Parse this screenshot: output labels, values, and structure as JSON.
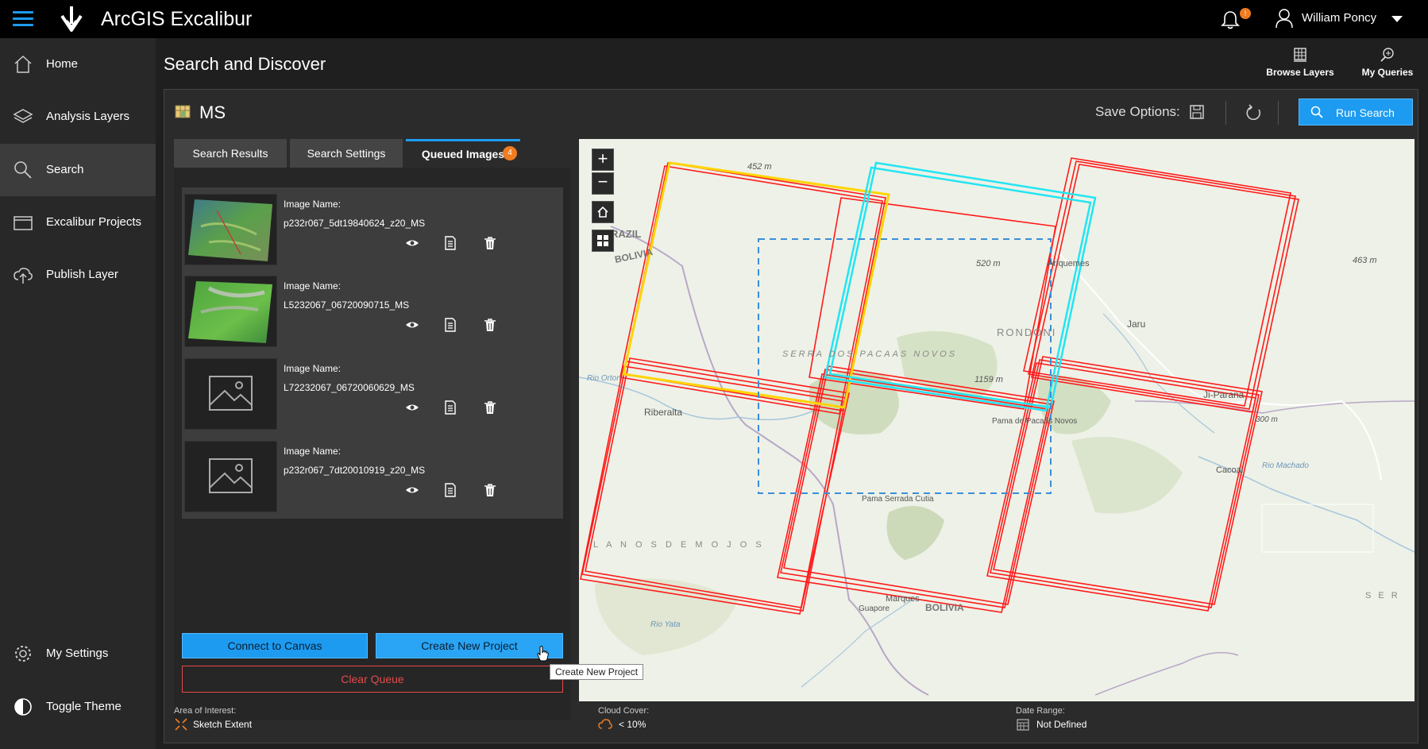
{
  "app": {
    "title": "ArcGIS Excalibur"
  },
  "user": {
    "name": "William Poncy",
    "notifications": "!"
  },
  "sidebar": {
    "items": [
      {
        "label": "Home"
      },
      {
        "label": "Analysis Layers"
      },
      {
        "label": "Search"
      },
      {
        "label": "Excalibur Projects"
      },
      {
        "label": "Publish Layer"
      },
      {
        "label": "My Settings"
      },
      {
        "label": "Toggle Theme"
      }
    ]
  },
  "page": {
    "title": "Search and Discover"
  },
  "top_actions": {
    "browse": "Browse Layers",
    "queries": "My Queries"
  },
  "panel": {
    "title": "MS",
    "save_options_label": "Save Options:",
    "run_search_label": "Run Search"
  },
  "tabs": [
    {
      "label": "Search Results"
    },
    {
      "label": "Search Settings"
    },
    {
      "label": "Queued Images",
      "badge": "4"
    }
  ],
  "queue": {
    "items": [
      {
        "label": "Image Name:",
        "name": "p232r067_5dt19840624_z20_MS",
        "thumb": "imagery"
      },
      {
        "label": "Image Name:",
        "name": "L5232067_06720090715_MS",
        "thumb": "imagery"
      },
      {
        "label": "Image Name:",
        "name": "L72232067_06720060629_MS",
        "thumb": "placeholder"
      },
      {
        "label": "Image Name:",
        "name": "p232r067_7dt20010919_z20_MS",
        "thumb": "placeholder"
      }
    ],
    "connect_label": "Connect to Canvas",
    "create_label": "Create New Project",
    "clear_label": "Clear Queue",
    "tooltip": "Create New Project"
  },
  "map": {
    "labels": {
      "elev_452": "452 m",
      "brazil": "RAZIL",
      "bolivia": "BOLIVIA",
      "elev_520": "520 m",
      "ariquemes": "Ariquemes",
      "elev_463": "463 m",
      "jaru": "Jaru",
      "rondonia": "RONDONI",
      "serra": "SERRA DOS PACAAS NOVOS",
      "rio_orton": "Rio Orton",
      "elev_1159": "1159 m",
      "riberalta": "Riberalta",
      "pama_pacaas": "Pama de Pacaás Novos",
      "jiparana": "Ji-Parana",
      "elev_300": "300 m",
      "cacoal": "Cacoal",
      "rio_machado": "Rio Machado",
      "pama_serrada": "Pama Serrada Cutia",
      "llanos": "L A N O S   D E   M O J O S",
      "marques": "Marques",
      "guapore": "Guapore",
      "bolivia_s": "BOLIVIA",
      "rio_yata": "Rio Yata",
      "serr_s": "S E R"
    },
    "colors": {
      "footprint": "#ff1a1a",
      "selected": "#ffd400",
      "highlight": "#22e5f2",
      "aoi": "#3a8fd8"
    }
  },
  "footer": {
    "aoi_label": "Area of Interest:",
    "aoi_value": "Sketch Extent",
    "cloud_label": "Cloud Cover:",
    "cloud_value": "< 10%",
    "date_label": "Date Range:",
    "date_value": "Not Defined"
  },
  "colors": {
    "accent": "#1d9bf0",
    "badge": "#f07c21",
    "danger": "#e34b4b"
  }
}
